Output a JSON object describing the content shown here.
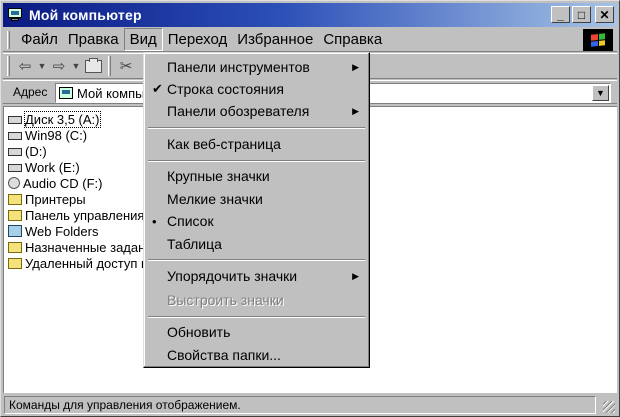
{
  "window": {
    "title": "Мой компьютер",
    "buttons": {
      "minimize": "_",
      "maximize": "□",
      "close": "✕"
    }
  },
  "menubar": {
    "items": [
      {
        "label": "Файл"
      },
      {
        "label": "Правка"
      },
      {
        "label": "Вид"
      },
      {
        "label": "Переход"
      },
      {
        "label": "Избранное"
      },
      {
        "label": "Справка"
      }
    ]
  },
  "toolbar": {
    "back_glyph": "⇦",
    "forward_glyph": "⇨",
    "dropdown_glyph": "▼",
    "cut_glyph": "✂"
  },
  "addressbar": {
    "label": "Адрес",
    "value": "Мой компьютер",
    "dropdown_glyph": "▼"
  },
  "content": {
    "items": [
      {
        "label": "Диск 3,5 (A:)",
        "icon": "floppy-drive-icon"
      },
      {
        "label": "Win98 (C:)",
        "icon": "hard-drive-icon"
      },
      {
        "label": "(D:)",
        "icon": "hard-drive-icon"
      },
      {
        "label": "Work (E:)",
        "icon": "hard-drive-icon"
      },
      {
        "label": "Audio CD (F:)",
        "icon": "cd-drive-icon"
      },
      {
        "label": "Принтеры",
        "icon": "printers-folder-icon"
      },
      {
        "label": "Панель управления",
        "icon": "control-panel-folder-icon"
      },
      {
        "label": "Web Folders",
        "icon": "web-folders-icon"
      },
      {
        "label": "Назначенные задания",
        "icon": "scheduled-tasks-folder-icon"
      },
      {
        "label": "Удаленный доступ к сети",
        "icon": "dial-up-folder-icon"
      }
    ]
  },
  "view_menu": {
    "items": [
      {
        "label": "Панели инструментов",
        "submenu": true,
        "mark": "",
        "disabled": false
      },
      {
        "label": "Строка состояния",
        "submenu": false,
        "mark": "✔",
        "disabled": false
      },
      {
        "label": "Панели обозревателя",
        "submenu": true,
        "mark": "",
        "disabled": false
      },
      {
        "label": "Как веб-страница",
        "submenu": false,
        "mark": "",
        "disabled": false
      },
      {
        "label": "Крупные значки",
        "submenu": false,
        "mark": "",
        "disabled": false
      },
      {
        "label": "Мелкие значки",
        "submenu": false,
        "mark": "",
        "disabled": false
      },
      {
        "label": "Список",
        "submenu": false,
        "mark": "•",
        "disabled": false
      },
      {
        "label": "Таблица",
        "submenu": false,
        "mark": "",
        "disabled": false
      },
      {
        "label": "Упорядочить значки",
        "submenu": true,
        "mark": "",
        "disabled": false
      },
      {
        "label": "Выстроить значки",
        "submenu": false,
        "mark": "",
        "disabled": true
      },
      {
        "label": "Обновить",
        "submenu": false,
        "mark": "",
        "disabled": false
      },
      {
        "label": "Свойства папки...",
        "submenu": false,
        "mark": "",
        "disabled": false
      }
    ],
    "submenu_glyph": "▶"
  },
  "statusbar": {
    "text": "Команды для управления отображением."
  },
  "colors": {
    "titlebar_start": "#0a1a82",
    "titlebar_end": "#a6c4e6",
    "face": "#c0c0c0"
  }
}
